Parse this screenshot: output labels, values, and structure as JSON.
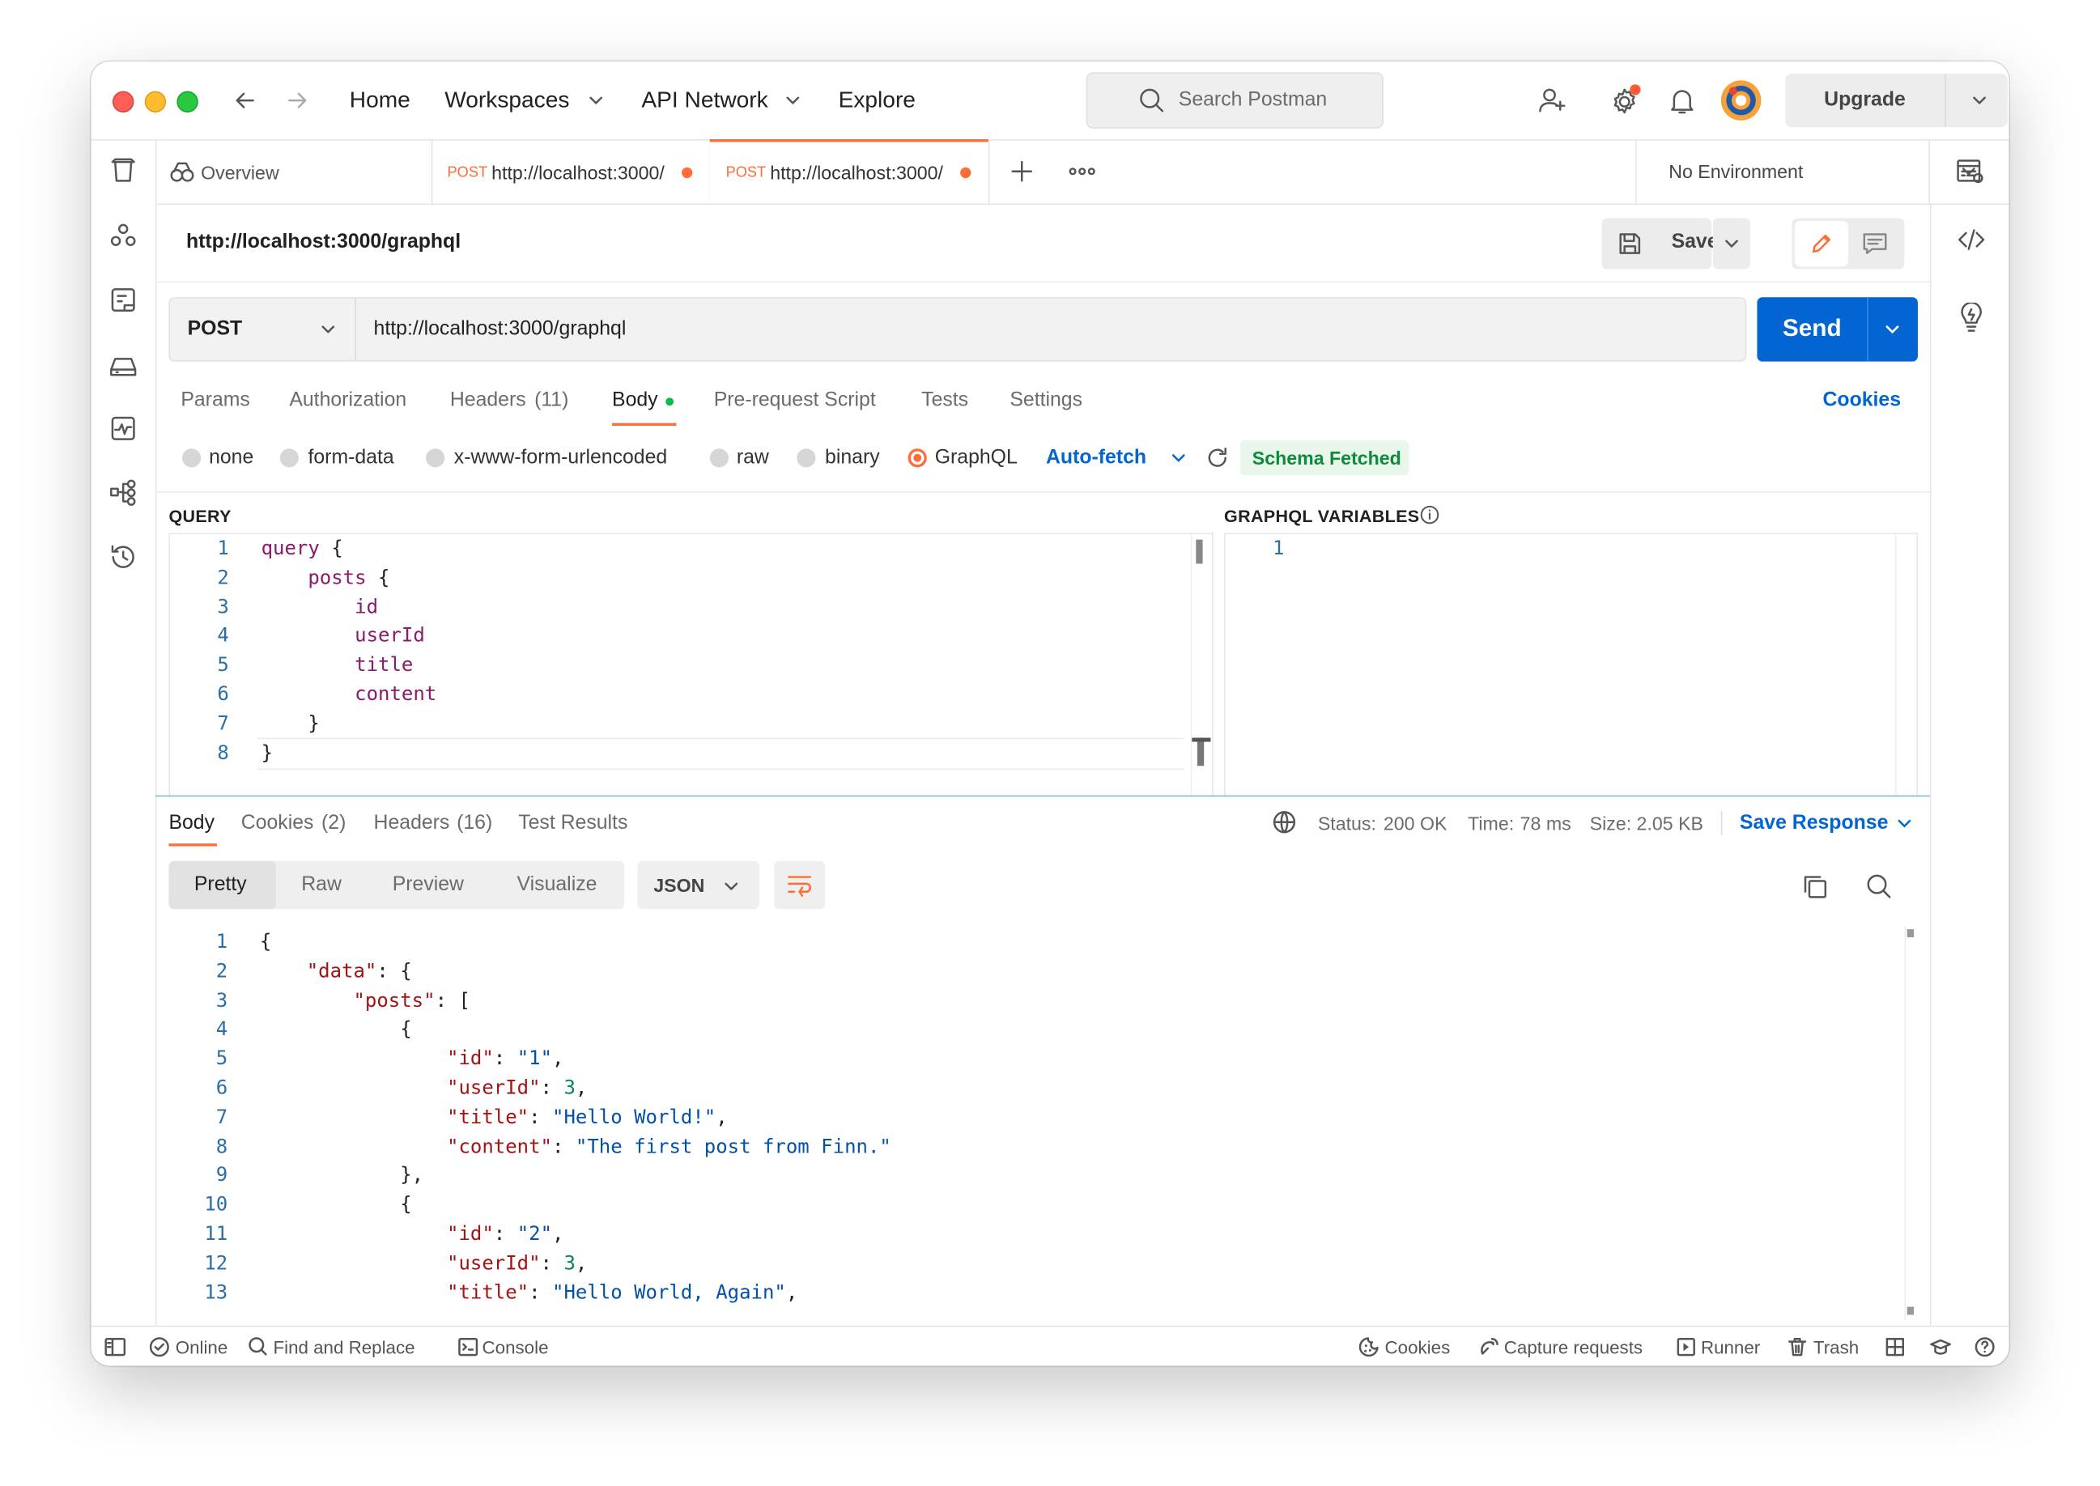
{
  "titlebar": {
    "nav": {
      "home": "Home",
      "workspaces": "Workspaces",
      "api_network": "API Network",
      "explore": "Explore"
    },
    "search_placeholder": "Search Postman",
    "upgrade": "Upgrade"
  },
  "tabs": {
    "overview": "Overview",
    "items": [
      {
        "method": "POST",
        "url": "http://localhost:3000/"
      },
      {
        "method": "POST",
        "url": "http://localhost:3000/"
      }
    ],
    "environment": "No Environment"
  },
  "request": {
    "title": "http://localhost:3000/graphql",
    "save": "Save",
    "method": "POST",
    "url": "http://localhost:3000/graphql",
    "send": "Send",
    "tabs": {
      "params": "Params",
      "authorization": "Authorization",
      "headers": "Headers",
      "headers_count": "(11)",
      "body": "Body",
      "prerequest": "Pre-request Script",
      "tests": "Tests",
      "settings": "Settings",
      "cookies": "Cookies"
    },
    "body_types": [
      "none",
      "form-data",
      "x-www-form-urlencoded",
      "raw",
      "binary",
      "GraphQL"
    ],
    "selected_body_type": "GraphQL",
    "auto_fetch": "Auto-fetch",
    "schema_status": "Schema Fetched"
  },
  "query": {
    "label": "QUERY",
    "lines": [
      [
        {
          "t": "query",
          "c": "kw"
        },
        {
          "t": " {",
          "c": "pun"
        }
      ],
      [
        {
          "t": "    posts",
          "c": "fld"
        },
        {
          "t": " {",
          "c": "pun"
        }
      ],
      [
        {
          "t": "        id",
          "c": "fld"
        }
      ],
      [
        {
          "t": "        userId",
          "c": "fld"
        }
      ],
      [
        {
          "t": "        title",
          "c": "fld"
        }
      ],
      [
        {
          "t": "        content",
          "c": "fld"
        }
      ],
      [
        {
          "t": "    }",
          "c": "pun"
        }
      ],
      [
        {
          "t": "}",
          "c": "pun"
        }
      ]
    ]
  },
  "variables": {
    "label": "GRAPHQL VARIABLES",
    "lines": [
      []
    ]
  },
  "response": {
    "tabs": {
      "body": "Body",
      "cookies": "Cookies",
      "cookies_count": "(2)",
      "headers": "Headers",
      "headers_count": "(16)",
      "test_results": "Test Results"
    },
    "status_label": "Status:",
    "status": "200 OK",
    "time_label": "Time:",
    "time": "78 ms",
    "size_label": "Size:",
    "size": "2.05 KB",
    "save_response": "Save Response",
    "views": [
      "Pretty",
      "Raw",
      "Preview",
      "Visualize"
    ],
    "active_view": "Pretty",
    "format": "JSON",
    "lines": [
      [
        {
          "t": "{",
          "c": "pun"
        }
      ],
      [
        {
          "t": "    ",
          "c": "pun"
        },
        {
          "t": "\"data\"",
          "c": "key"
        },
        {
          "t": ": {",
          "c": "pun"
        }
      ],
      [
        {
          "t": "        ",
          "c": "pun"
        },
        {
          "t": "\"posts\"",
          "c": "key"
        },
        {
          "t": ": [",
          "c": "pun"
        }
      ],
      [
        {
          "t": "            {",
          "c": "pun"
        }
      ],
      [
        {
          "t": "                ",
          "c": "pun"
        },
        {
          "t": "\"id\"",
          "c": "key"
        },
        {
          "t": ": ",
          "c": "pun"
        },
        {
          "t": "\"1\"",
          "c": "str"
        },
        {
          "t": ",",
          "c": "pun"
        }
      ],
      [
        {
          "t": "                ",
          "c": "pun"
        },
        {
          "t": "\"userId\"",
          "c": "key"
        },
        {
          "t": ": ",
          "c": "pun"
        },
        {
          "t": "3",
          "c": "num"
        },
        {
          "t": ",",
          "c": "pun"
        }
      ],
      [
        {
          "t": "                ",
          "c": "pun"
        },
        {
          "t": "\"title\"",
          "c": "key"
        },
        {
          "t": ": ",
          "c": "pun"
        },
        {
          "t": "\"Hello World!\"",
          "c": "str"
        },
        {
          "t": ",",
          "c": "pun"
        }
      ],
      [
        {
          "t": "                ",
          "c": "pun"
        },
        {
          "t": "\"content\"",
          "c": "key"
        },
        {
          "t": ": ",
          "c": "pun"
        },
        {
          "t": "\"The first post from Finn.\"",
          "c": "str"
        }
      ],
      [
        {
          "t": "            },",
          "c": "pun"
        }
      ],
      [
        {
          "t": "            {",
          "c": "pun"
        }
      ],
      [
        {
          "t": "                ",
          "c": "pun"
        },
        {
          "t": "\"id\"",
          "c": "key"
        },
        {
          "t": ": ",
          "c": "pun"
        },
        {
          "t": "\"2\"",
          "c": "str"
        },
        {
          "t": ",",
          "c": "pun"
        }
      ],
      [
        {
          "t": "                ",
          "c": "pun"
        },
        {
          "t": "\"userId\"",
          "c": "key"
        },
        {
          "t": ": ",
          "c": "pun"
        },
        {
          "t": "3",
          "c": "num"
        },
        {
          "t": ",",
          "c": "pun"
        }
      ],
      [
        {
          "t": "                ",
          "c": "pun"
        },
        {
          "t": "\"title\"",
          "c": "key"
        },
        {
          "t": ": ",
          "c": "pun"
        },
        {
          "t": "\"Hello World, Again\"",
          "c": "str"
        },
        {
          "t": ",",
          "c": "pun"
        }
      ]
    ]
  },
  "footer": {
    "online": "Online",
    "find_replace": "Find and Replace",
    "console": "Console",
    "cookies": "Cookies",
    "capture": "Capture requests",
    "runner": "Runner",
    "trash": "Trash"
  },
  "colors": {
    "accent": "#ff6c37",
    "send": "#0265d2",
    "success": "#0d8a3a",
    "link": "#0265d2"
  }
}
